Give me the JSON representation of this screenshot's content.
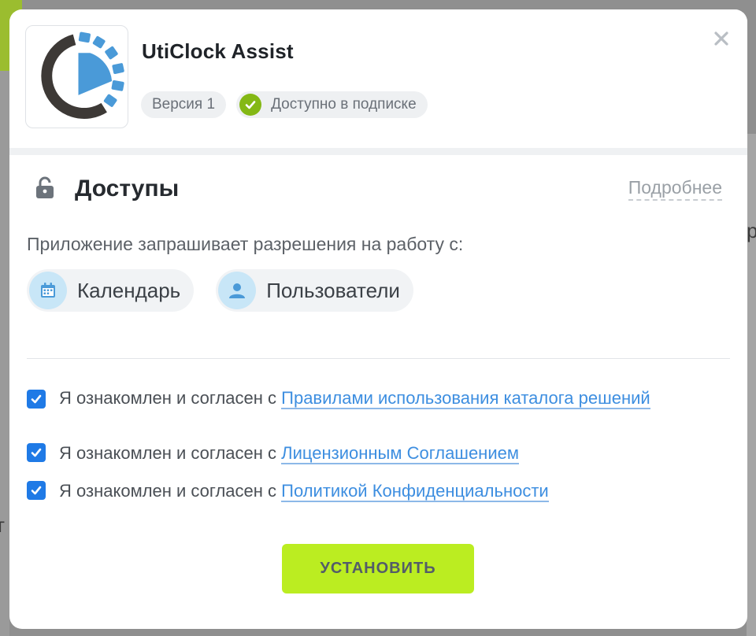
{
  "background": {
    "fragment_right": "р",
    "fragment_left": "т"
  },
  "app": {
    "title": "UtiClock Assist",
    "version_label": "Версия 1",
    "subscription_label": "Доступно в подписке",
    "logo_icon": "uticlock-logo"
  },
  "access": {
    "title": "Доступы",
    "more_link": "Подробнее",
    "description": "Приложение запрашивает разрешения на работу с:",
    "scopes": [
      {
        "label": "Календарь",
        "icon": "calendar-icon"
      },
      {
        "label": "Пользователи",
        "icon": "user-icon"
      }
    ]
  },
  "agreements": [
    {
      "prefix": "Я ознакомлен и согласен с ",
      "link": "Правилами использования каталога решений",
      "checked": true
    },
    {
      "prefix": "Я ознакомлен и согласен с ",
      "link": "Лицензионным Соглашением",
      "checked": true
    },
    {
      "prefix": "Я ознакомлен и согласен с ",
      "link": "Политикой Конфиденциальности",
      "checked": true
    }
  ],
  "install_label": "УСТАНОВИТЬ",
  "colors": {
    "accent_button": "#bbed21",
    "checkbox": "#1f7ae6",
    "link": "#3d8ee0",
    "check_badge": "#84b815"
  }
}
